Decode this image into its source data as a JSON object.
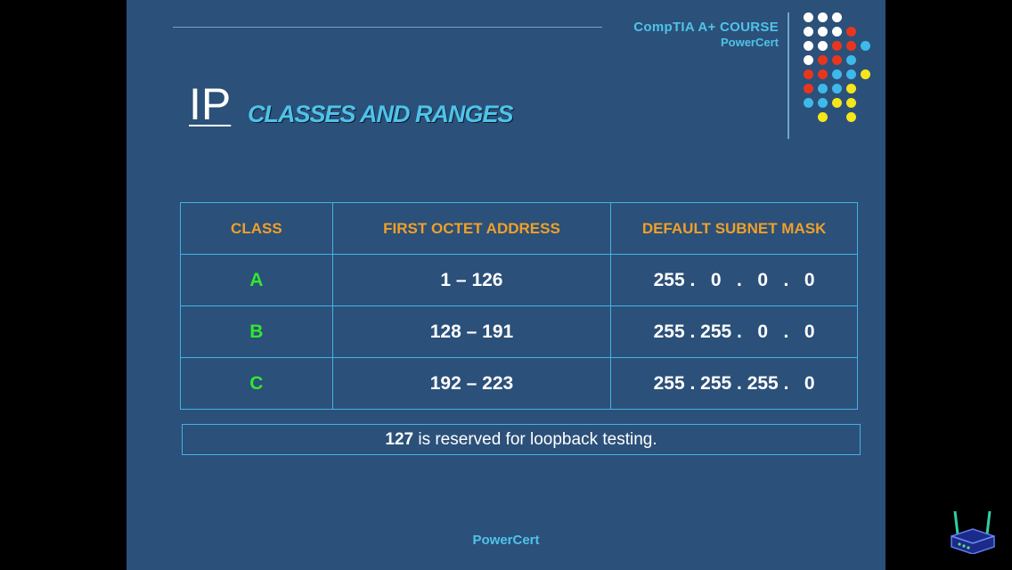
{
  "header": {
    "course": "CompTIA A+ COURSE",
    "brand": "PowerCert"
  },
  "title": {
    "main": "IP",
    "sub": "CLASSES AND RANGES"
  },
  "table": {
    "headers": [
      "CLASS",
      "FIRST OCTET ADDRESS",
      "DEFAULT SUBNET MASK"
    ],
    "rows": [
      {
        "class": "A",
        "range": "1 – 126",
        "mask": "255 .   0   .   0   .   0"
      },
      {
        "class": "B",
        "range": "128 – 191",
        "mask": "255 . 255 .   0   .   0"
      },
      {
        "class": "C",
        "range": "192 – 223",
        "mask": "255 . 255 . 255 .   0"
      }
    ]
  },
  "note": {
    "bold": "127",
    "text": " is reserved for loopback testing."
  },
  "footer": "PowerCert",
  "colors": {
    "background": "#2b5079",
    "accent": "#4fc3ea",
    "header_text": "#f0a028",
    "class_text": "#33e633",
    "dot_white": "#ffffff",
    "dot_red": "#e8361e",
    "dot_blue": "#3fb8ea",
    "dot_yellow": "#f5e61a"
  },
  "icons": {
    "corner": "router-icon"
  }
}
